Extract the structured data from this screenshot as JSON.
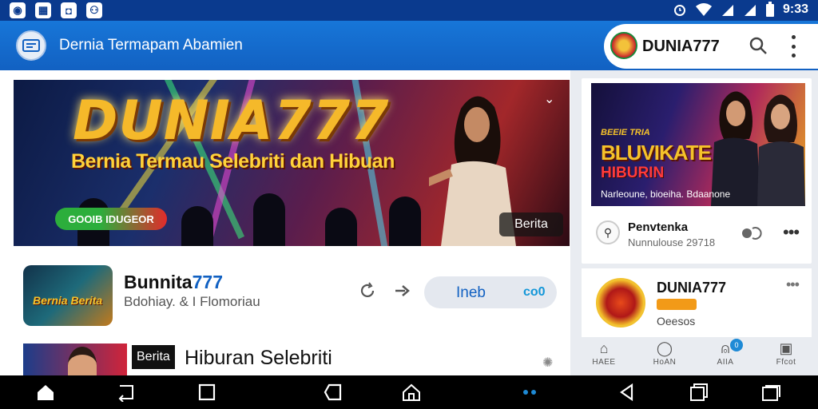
{
  "statusbar": {
    "left_icons": [
      "notification-icon",
      "gallery-icon",
      "app-icon",
      "game-icon"
    ],
    "left_glyphs": [
      "◉",
      "▦",
      "◘",
      "⚇"
    ],
    "time": "9:33"
  },
  "appbar": {
    "title": "Dernia Termapam Abamien",
    "brand": "DUNIA777"
  },
  "hero": {
    "title": "DUNIA777",
    "subtitle": "Bernia Termau Selebriti dan Hibuan",
    "cta": "GOOIB IDUGEOR",
    "tag": "Berita"
  },
  "row1": {
    "thumb_text": "Bernia Berita",
    "title_main": "Bunnita",
    "title_accent": "777",
    "subtitle": "Bdohiay. & I Flomoriau",
    "button_label": "Ineb",
    "button_count": "co0"
  },
  "row2": {
    "tag": "Berita",
    "title": "Hiburan Selebriti"
  },
  "side_card1": {
    "kicker": "BEEIE TRIA",
    "headline1": "BLUVIKATE",
    "headline2": "HIBURIN",
    "caption": "Narleoune, bioeiha. Bdaanone",
    "author": "Penvtenka",
    "meta": "Nunnulouse 29718"
  },
  "side_card2": {
    "name": "DUNIA777",
    "subtitle": "Oeesos"
  },
  "sidenav": {
    "items": [
      {
        "icon": "home-icon",
        "glyph": "⌂",
        "label": "HAEE"
      },
      {
        "icon": "chat-icon",
        "glyph": "◯",
        "label": "HoAN"
      },
      {
        "icon": "notification-bell-icon",
        "glyph": "⍝",
        "label": "AIIA",
        "badge": "0"
      },
      {
        "icon": "profile-icon",
        "glyph": "▣",
        "label": "Ffcot"
      }
    ]
  },
  "colors": {
    "primary": "#1261c2",
    "statusbar": "#0a3a8e",
    "hero_gold": "#f5b92a"
  }
}
